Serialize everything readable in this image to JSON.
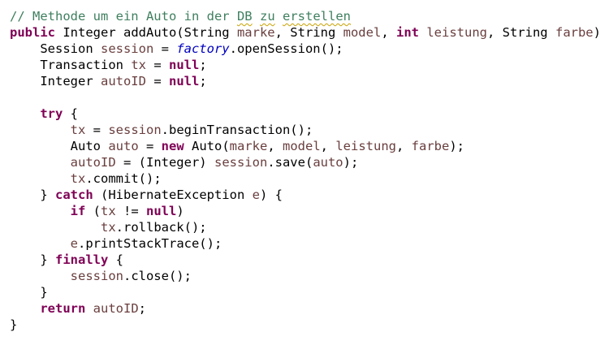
{
  "editor": {
    "colors": {
      "keyword": "#7f0055",
      "local_variable": "#6a3e3e",
      "comment": "#3f7f5f",
      "field": "#0000c0",
      "plain": "#000000",
      "background": "#ffffff",
      "spelling_squiggle": "#c8a200"
    },
    "lines": [
      [
        {
          "t": "// Methode um ein Auto in der ",
          "c": "comment"
        },
        {
          "t": "DB",
          "c": "comment",
          "squiggle": true
        },
        {
          "t": " ",
          "c": "comment"
        },
        {
          "t": "zu",
          "c": "comment",
          "squiggle": true
        },
        {
          "t": " ",
          "c": "comment"
        },
        {
          "t": "erstellen",
          "c": "comment",
          "squiggle": true
        }
      ],
      [
        {
          "t": "public",
          "c": "kw"
        },
        {
          "t": " Integer addAuto(String ",
          "c": "plain"
        },
        {
          "t": "marke",
          "c": "var"
        },
        {
          "t": ", String ",
          "c": "plain"
        },
        {
          "t": "model",
          "c": "var"
        },
        {
          "t": ", ",
          "c": "plain"
        },
        {
          "t": "int",
          "c": "kw"
        },
        {
          "t": " ",
          "c": "plain"
        },
        {
          "t": "leistung",
          "c": "var"
        },
        {
          "t": ", String ",
          "c": "plain"
        },
        {
          "t": "farbe",
          "c": "var"
        },
        {
          "t": ") {",
          "c": "plain"
        }
      ],
      [
        {
          "t": "    Session ",
          "c": "plain"
        },
        {
          "t": "session",
          "c": "var"
        },
        {
          "t": " = ",
          "c": "plain"
        },
        {
          "t": "factory",
          "c": "field"
        },
        {
          "t": ".openSession();",
          "c": "plain"
        }
      ],
      [
        {
          "t": "    Transaction ",
          "c": "plain"
        },
        {
          "t": "tx",
          "c": "var"
        },
        {
          "t": " = ",
          "c": "plain"
        },
        {
          "t": "null",
          "c": "kw"
        },
        {
          "t": ";",
          "c": "plain"
        }
      ],
      [
        {
          "t": "    Integer ",
          "c": "plain"
        },
        {
          "t": "autoID",
          "c": "var"
        },
        {
          "t": " = ",
          "c": "plain"
        },
        {
          "t": "null",
          "c": "kw"
        },
        {
          "t": ";",
          "c": "plain"
        }
      ],
      [],
      [
        {
          "t": "    ",
          "c": "plain"
        },
        {
          "t": "try",
          "c": "kw"
        },
        {
          "t": " {",
          "c": "plain"
        }
      ],
      [
        {
          "t": "        ",
          "c": "plain"
        },
        {
          "t": "tx",
          "c": "var"
        },
        {
          "t": " = ",
          "c": "plain"
        },
        {
          "t": "session",
          "c": "var"
        },
        {
          "t": ".beginTransaction();",
          "c": "plain"
        }
      ],
      [
        {
          "t": "        Auto ",
          "c": "plain"
        },
        {
          "t": "auto",
          "c": "var"
        },
        {
          "t": " = ",
          "c": "plain"
        },
        {
          "t": "new",
          "c": "kw"
        },
        {
          "t": " Auto(",
          "c": "plain"
        },
        {
          "t": "marke",
          "c": "var"
        },
        {
          "t": ", ",
          "c": "plain"
        },
        {
          "t": "model",
          "c": "var"
        },
        {
          "t": ", ",
          "c": "plain"
        },
        {
          "t": "leistung",
          "c": "var"
        },
        {
          "t": ", ",
          "c": "plain"
        },
        {
          "t": "farbe",
          "c": "var"
        },
        {
          "t": ");",
          "c": "plain"
        }
      ],
      [
        {
          "t": "        ",
          "c": "plain"
        },
        {
          "t": "autoID",
          "c": "var"
        },
        {
          "t": " = (Integer) ",
          "c": "plain"
        },
        {
          "t": "session",
          "c": "var"
        },
        {
          "t": ".save(",
          "c": "plain"
        },
        {
          "t": "auto",
          "c": "var"
        },
        {
          "t": ");",
          "c": "plain"
        }
      ],
      [
        {
          "t": "        ",
          "c": "plain"
        },
        {
          "t": "tx",
          "c": "var"
        },
        {
          "t": ".commit();",
          "c": "plain"
        }
      ],
      [
        {
          "t": "    } ",
          "c": "plain"
        },
        {
          "t": "catch",
          "c": "kw"
        },
        {
          "t": " (HibernateException ",
          "c": "plain"
        },
        {
          "t": "e",
          "c": "var"
        },
        {
          "t": ") {",
          "c": "plain"
        }
      ],
      [
        {
          "t": "        ",
          "c": "plain"
        },
        {
          "t": "if",
          "c": "kw"
        },
        {
          "t": " (",
          "c": "plain"
        },
        {
          "t": "tx",
          "c": "var"
        },
        {
          "t": " != ",
          "c": "plain"
        },
        {
          "t": "null",
          "c": "kw"
        },
        {
          "t": ")",
          "c": "plain"
        }
      ],
      [
        {
          "t": "            ",
          "c": "plain"
        },
        {
          "t": "tx",
          "c": "var"
        },
        {
          "t": ".rollback();",
          "c": "plain"
        }
      ],
      [
        {
          "t": "        ",
          "c": "plain"
        },
        {
          "t": "e",
          "c": "var"
        },
        {
          "t": ".printStackTrace();",
          "c": "plain"
        }
      ],
      [
        {
          "t": "    } ",
          "c": "plain"
        },
        {
          "t": "finally",
          "c": "kw"
        },
        {
          "t": " {",
          "c": "plain"
        }
      ],
      [
        {
          "t": "        ",
          "c": "plain"
        },
        {
          "t": "session",
          "c": "var"
        },
        {
          "t": ".close();",
          "c": "plain"
        }
      ],
      [
        {
          "t": "    }",
          "c": "plain"
        }
      ],
      [
        {
          "t": "    ",
          "c": "plain"
        },
        {
          "t": "return",
          "c": "kw"
        },
        {
          "t": " ",
          "c": "plain"
        },
        {
          "t": "autoID",
          "c": "var"
        },
        {
          "t": ";",
          "c": "plain"
        }
      ],
      [
        {
          "t": "}",
          "c": "plain"
        }
      ]
    ]
  }
}
